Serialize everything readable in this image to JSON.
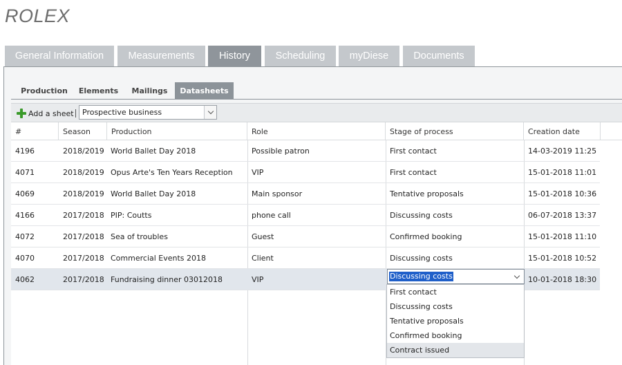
{
  "app": {
    "title": "ROLEX"
  },
  "main_tabs": [
    {
      "label": "General Information"
    },
    {
      "label": "Measurements"
    },
    {
      "label": "History"
    },
    {
      "label": "Scheduling"
    },
    {
      "label": "myDiese"
    },
    {
      "label": "Documents"
    }
  ],
  "main_tab_active": "History",
  "sub_tabs": [
    {
      "label": "Production"
    },
    {
      "label": "Elements"
    },
    {
      "label": "Mailings"
    },
    {
      "label": "Datasheets"
    }
  ],
  "sub_tab_active": "Datasheets",
  "toolbar": {
    "add_sheet_label": "Add a sheet",
    "separator": "|",
    "sheet_select_value": "Prospective business"
  },
  "grid": {
    "columns": [
      "#",
      "Season",
      "Production",
      "Role",
      "Stage of process",
      "Creation date"
    ],
    "rows": [
      {
        "id": "4196",
        "season": "2018/2019",
        "production": "World Ballet Day 2018",
        "role": "Possible patron",
        "stage": "First contact",
        "created": "14-03-2019 11:25"
      },
      {
        "id": "4071",
        "season": "2018/2019",
        "production": "Opus Arte's Ten Years Reception",
        "role": "VIP",
        "stage": "First contact",
        "created": "15-01-2018 11:01"
      },
      {
        "id": "4069",
        "season": "2018/2019",
        "production": "World Ballet Day 2018",
        "role": "Main sponsor",
        "stage": "Tentative proposals",
        "created": "15-01-2018 10:36"
      },
      {
        "id": "4166",
        "season": "2017/2018",
        "production": "PIP: Coutts",
        "role": "phone call",
        "stage": "Discussing costs",
        "created": "06-07-2018 13:37"
      },
      {
        "id": "4072",
        "season": "2017/2018",
        "production": "Sea of troubles",
        "role": "Guest",
        "stage": "Confirmed booking",
        "created": "15-01-2018 11:10"
      },
      {
        "id": "4070",
        "season": "2017/2018",
        "production": "Commercial Events 2018",
        "role": "Client",
        "stage": "Discussing costs",
        "created": "15-01-2018 10:52"
      },
      {
        "id": "4062",
        "season": "2017/2018",
        "production": "Fundraising dinner 03012018",
        "role": "VIP",
        "stage": "",
        "created": "10-01-2018 18:30"
      }
    ],
    "selected_row_id": "4062"
  },
  "stage_editor": {
    "value": "Discussing costs",
    "options": [
      "First contact",
      "Discussing costs",
      "Tentative proposals",
      "Confirmed booking",
      "Contract issued"
    ],
    "hovered_option": "Contract issued"
  },
  "colors": {
    "main_tab_bg": "#c4c8cc",
    "main_tab_active_bg": "#8f959b",
    "sub_tab_active_bg": "#8c9399",
    "selection_highlight": "#1f5fc9",
    "selected_row_bg": "#e1e6ec",
    "add_icon": "#3a9a2a"
  },
  "icons": {
    "add_sheet": "plus-icon",
    "dropdown": "chevron-down-icon"
  }
}
